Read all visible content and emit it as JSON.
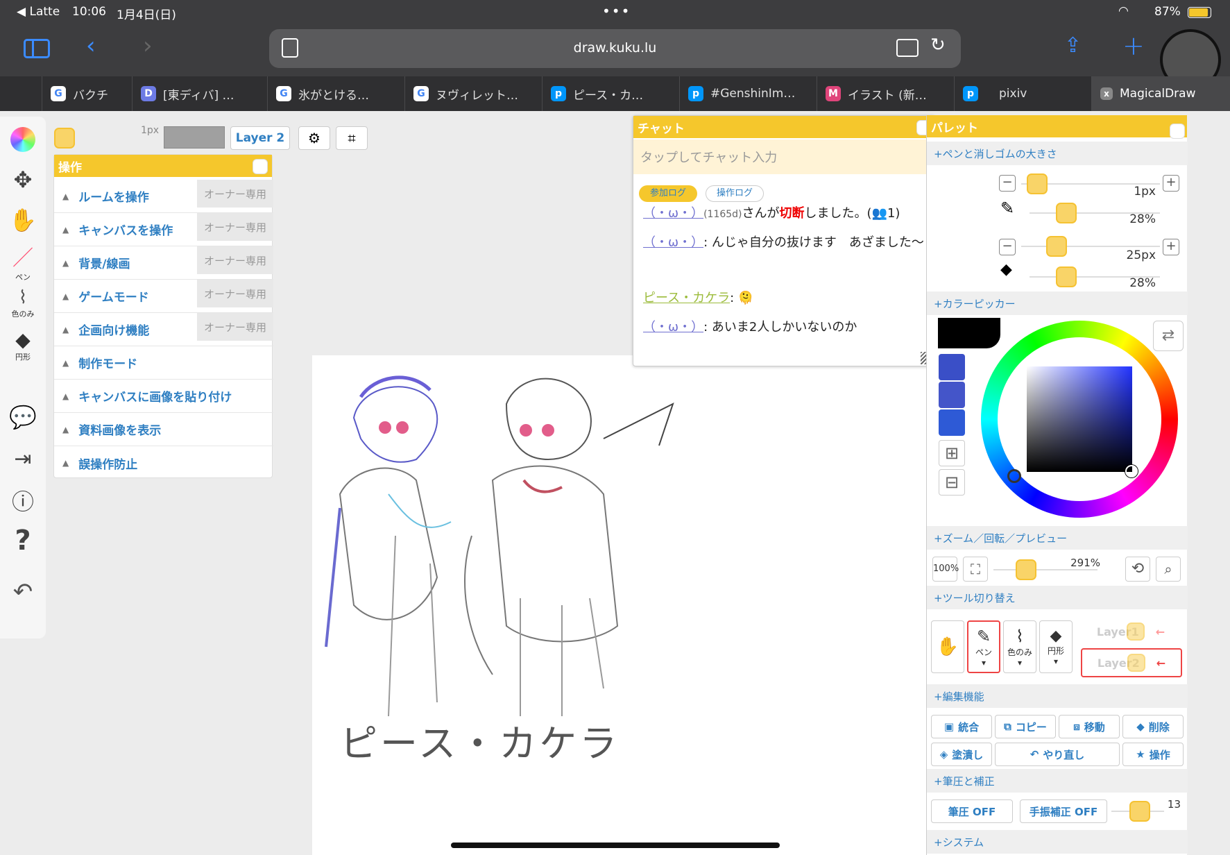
{
  "status": {
    "back_app": "◀ Latte",
    "time": "10:06",
    "date": "1月4日(日)",
    "battery": "87%"
  },
  "browser": {
    "url": "draw.kuku.lu"
  },
  "tabs": [
    {
      "label": "バクチ",
      "fav": "G"
    },
    {
      "label": "[東ディバ] …",
      "fav": "D"
    },
    {
      "label": "氷がとける…",
      "fav": "G"
    },
    {
      "label": "ヌヴィレット…",
      "fav": "G"
    },
    {
      "label": "ピース・カ…",
      "fav": "p"
    },
    {
      "label": "#GenshinIm…",
      "fav": "p"
    },
    {
      "label": "イラスト (新…",
      "fav": "M"
    },
    {
      "label": "pixiv",
      "fav": "p"
    },
    {
      "label": "MagicalDraw",
      "fav": "x"
    }
  ],
  "left_tools": {
    "pen_label": "ペン",
    "picker_label": "色のみ",
    "shape_label": "円形"
  },
  "top_controls": {
    "size": "1px",
    "layer_button": "Layer 2"
  },
  "op_panel": {
    "title": "操作",
    "items": [
      {
        "label": "ルームを操作",
        "owner": "オーナー専用"
      },
      {
        "label": "キャンバスを操作",
        "owner": "オーナー専用"
      },
      {
        "label": "背景/線画",
        "owner": "オーナー専用"
      },
      {
        "label": "ゲームモード",
        "owner": "オーナー専用"
      },
      {
        "label": "企画向け機能",
        "owner": "オーナー専用"
      },
      {
        "label": "制作モード",
        "owner": ""
      },
      {
        "label": "キャンバスに画像を貼り付け",
        "owner": ""
      },
      {
        "label": "資料画像を表示",
        "owner": ""
      },
      {
        "label": "誤操作防止",
        "owner": ""
      }
    ]
  },
  "chat": {
    "title": "チャット",
    "placeholder": "タップしてチャット入力",
    "tab_join": "参加ログ",
    "tab_op": "操作ログ",
    "line1_nick": "（・ω・）",
    "line1_meta": "(1165d)",
    "line1_a": "さんが",
    "line1_cut": "切断",
    "line1_b": "しました。(",
    "line1_count": "1)",
    "line2_nick": "（・ω・）",
    "line2_text": ": んじゃ自分の抜けます　あざました～",
    "line3_nick": "ピース・カケラ",
    "line3_text": ": 🫠",
    "line4_nick": "（・ω・）",
    "line4_text": ": あいま2人しかいないのか"
  },
  "palette": {
    "title": "パレット",
    "pen_eraser_section": "+ペンと消しゴムの大きさ",
    "pen_size": "1px",
    "pen_opacity": "28%",
    "eraser_size": "25px",
    "eraser_opacity": "28%",
    "color_picker_section": "+カラーピッカー",
    "zoom_section": "+ズーム／回転／プレビュー",
    "zoom_100": "100%",
    "zoom_value": "291%",
    "tool_switch_section": "+ツール切り替え",
    "tool_pen": "ペン",
    "tool_picker": "色のみ",
    "tool_shape": "円形",
    "layer1": "Layer1",
    "layer2": "Layer2",
    "edit_section": "+編集機能",
    "edit_merge": "統合",
    "edit_copy": "コピー",
    "edit_move": "移動",
    "edit_delete": "削除",
    "edit_fill": "塗潰し",
    "edit_redo": "やり直し",
    "edit_ops": "操作",
    "pressure_section": "+筆圧と補正",
    "pressure_btn": "筆圧 OFF",
    "stabilizer_btn": "手振補正 OFF",
    "stabilizer_value": "13",
    "system_section": "+システム",
    "swatches": [
      "#3a4fc7",
      "#4455c9",
      "#2e5ad6"
    ]
  },
  "canvas": {
    "signature": "ピース・カケラ"
  },
  "colors": {
    "accent": "#f5c72c",
    "link": "#2f7fc2",
    "chrome": "#3d3d3f"
  }
}
